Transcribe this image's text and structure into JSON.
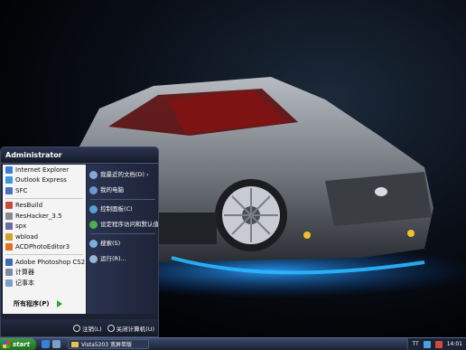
{
  "start_menu": {
    "user": "Administrator",
    "pinned": [
      {
        "label": "Internet Explorer",
        "icon": "ie-icon",
        "color": "#3b7fd6"
      },
      {
        "label": "Outlook Express",
        "icon": "outlook-icon",
        "color": "#3a9ad9"
      },
      {
        "label": "SFC",
        "icon": "sfc-icon",
        "color": "#4a6fc4"
      }
    ],
    "recent": [
      {
        "label": "ResBuild",
        "icon": "resbuild-icon",
        "color": "#c84a3a"
      },
      {
        "label": "ResHacker_3.5",
        "icon": "reshacker-icon",
        "color": "#8a8a8a"
      },
      {
        "label": "spx",
        "icon": "spx-icon",
        "color": "#6a6aa8"
      },
      {
        "label": "wbload",
        "icon": "wbload-icon",
        "color": "#d0a030"
      },
      {
        "label": "ACDPhotoEditor3",
        "icon": "acd-icon",
        "color": "#e07020"
      }
    ],
    "recent2": [
      {
        "label": "Adobe Photoshop CS2",
        "icon": "photoshop-icon",
        "color": "#3a6ab0"
      },
      {
        "label": "计算器",
        "icon": "calculator-icon",
        "color": "#7a8aa0"
      },
      {
        "label": "记事本",
        "icon": "notepad-icon",
        "color": "#7aa0c8"
      }
    ],
    "all_programs": "所有程序(P)",
    "right": [
      {
        "label": "我最近的文档(D)",
        "icon": "recent-docs-icon",
        "color": "#8aa6d8",
        "arrow": "›"
      },
      {
        "label": "我的电脑",
        "icon": "my-computer-icon",
        "color": "#6a9ad0",
        "arrow": ""
      },
      {
        "label": "控制面板(C)",
        "icon": "control-panel-icon",
        "color": "#5aa0d8",
        "arrow": ""
      },
      {
        "label": "设定程序访问和默认值",
        "icon": "program-defaults-icon",
        "color": "#4caf50",
        "arrow": ""
      },
      {
        "label": "搜索(S)",
        "icon": "search-icon",
        "color": "#7ab0e0",
        "arrow": ""
      },
      {
        "label": "运行(R)...",
        "icon": "run-icon",
        "color": "#9ab4d8",
        "arrow": ""
      }
    ],
    "logoff": "注销(L)",
    "shutdown": "关闭计算机(U)"
  },
  "taskbar": {
    "start_label": "start",
    "task": "Vista5203 宽屏单版",
    "tray_text": "TT",
    "clock": "14:01"
  }
}
